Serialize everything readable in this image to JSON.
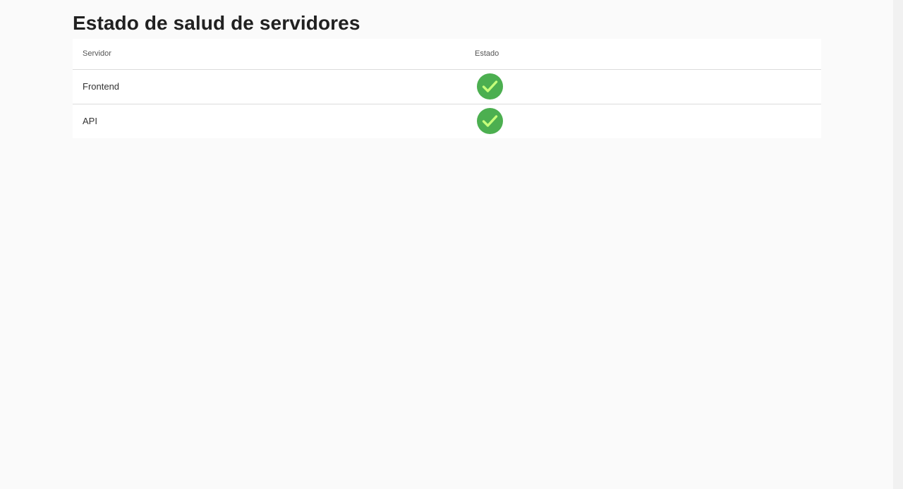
{
  "page": {
    "title": "Estado de salud de servidores"
  },
  "table": {
    "columns": {
      "server": "Servidor",
      "status": "Estado"
    },
    "rows": [
      {
        "server": "Frontend",
        "status_icon": "check-circle-icon",
        "status": "ok"
      },
      {
        "server": "API",
        "status_icon": "check-circle-icon",
        "status": "ok"
      }
    ]
  },
  "colors": {
    "status_ok": "#4caf50",
    "check_mark": "#c6ff7a",
    "background": "#fafafa"
  }
}
